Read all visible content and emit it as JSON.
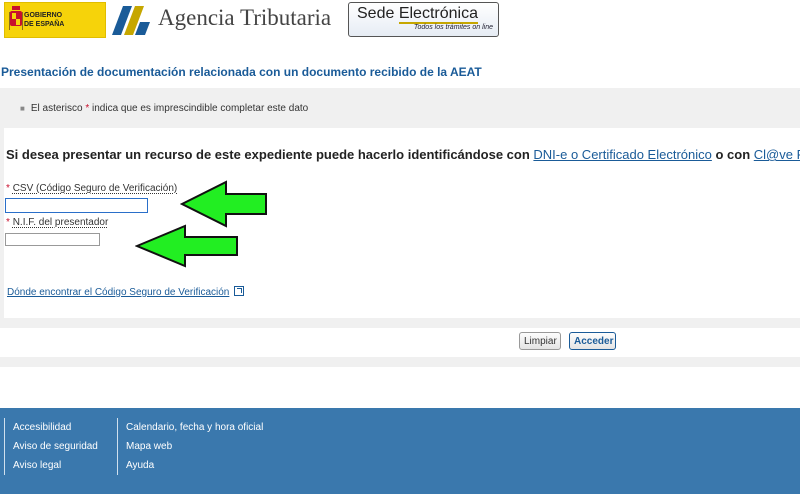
{
  "header": {
    "gobierno_line1": "GOBIERNO",
    "gobierno_line2": "DE ESPAÑA",
    "agencia": "Agencia Tributaria",
    "sede_part1": "Sede ",
    "sede_part2": "Electrónica",
    "sede_tagline": "Todos los trámites on line",
    "colors": {
      "gobierno_yellow": "#f6d30a",
      "aeat_blue": "#1a5b98",
      "aeat_gold": "#c6a700"
    }
  },
  "page": {
    "title": "Presentación de documentación relacionada con un documento recibido de la AEAT"
  },
  "note": {
    "prefix": "El asterisco ",
    "star": "*",
    "suffix": " indica que es imprescindible completar este dato"
  },
  "form": {
    "intro_prefix": "Si desea presentar un recurso de este expediente puede hacerlo identificándose con ",
    "link_dni": "DNI-e o Certificado Electrónico",
    "intro_middle": " o con ",
    "link_clave": "Cl@ve PIN",
    "intro_suffix": ".",
    "csv_label": "CSV (Código Seguro de Verificación)",
    "csv_value": "",
    "nif_label": "N.I.F. del presentador",
    "nif_value": "",
    "required_mark": "*",
    "csv_help_link": "Dónde encontrar el Código Seguro de Verificación"
  },
  "buttons": {
    "limpiar": "Limpiar",
    "acceder": "Acceder"
  },
  "footer": {
    "col1": [
      "Accesibilidad",
      "Aviso de seguridad",
      "Aviso legal"
    ],
    "col2": [
      "Calendario, fecha y hora oficial",
      "Mapa web",
      "Ayuda"
    ],
    "background": "#3a78ad"
  }
}
